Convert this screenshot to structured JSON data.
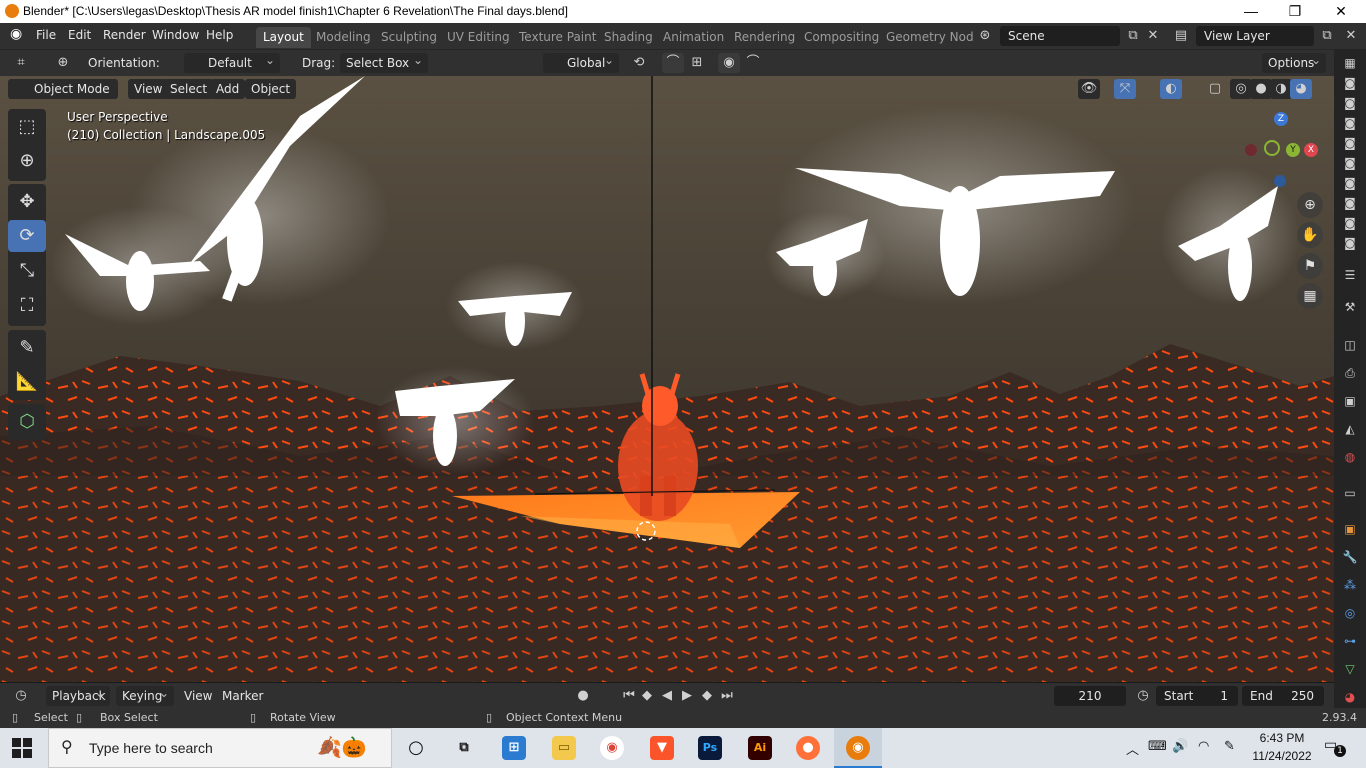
{
  "window": {
    "title": "Blender* [C:\\Users\\legas\\Desktop\\Thesis AR model finish1\\Chapter 6 Revelation\\The Final days.blend]",
    "minimize_icon": "minimize-icon",
    "maximize_icon": "maximize-icon",
    "close_icon": "close-icon"
  },
  "menubar": {
    "menus": [
      "File",
      "Edit",
      "Render",
      "Window",
      "Help"
    ],
    "workspaces": [
      "Layout",
      "Modeling",
      "Sculpting",
      "UV Editing",
      "Texture Paint",
      "Shading",
      "Animation",
      "Rendering",
      "Compositing",
      "Geometry Nod"
    ],
    "active_workspace": "Layout",
    "scene": "Scene",
    "view_layer": "View Layer"
  },
  "toolheader": {
    "orientation_label": "Orientation:",
    "orientation_value": "Default",
    "drag_label": "Drag:",
    "drag_value": "Select Box",
    "transform_orientation": "Global",
    "options_label": "Options"
  },
  "viewport_header": {
    "mode": "Object Mode",
    "menus": [
      "View",
      "Select",
      "Add",
      "Object"
    ]
  },
  "viewport": {
    "perspective": "User Perspective",
    "collection_info": "(210) Collection | Landscape.005",
    "gizmo": {
      "z": "Z",
      "y": "Y",
      "x": "X"
    }
  },
  "timeline": {
    "menus": [
      "Playback",
      "Keying",
      "View",
      "Marker"
    ],
    "current_frame": "210",
    "start_label": "Start",
    "start_value": "1",
    "end_label": "End",
    "end_value": "250"
  },
  "statusbar": {
    "select": "Select",
    "box_select": "Box Select",
    "rotate_view": "Rotate View",
    "context_menu": "Object Context Menu",
    "version": "2.93.4"
  },
  "taskbar": {
    "search_placeholder": "Type here to search",
    "time": "6:43 PM",
    "date": "11/24/2022",
    "notifications": "1",
    "apps": [
      "task-view",
      "store",
      "file-explorer",
      "chrome",
      "brave",
      "photoshop",
      "illustrator",
      "firefox",
      "blender"
    ]
  },
  "colors": {
    "accent": "#4772b3",
    "lava": "#ff5a14",
    "blender_orange": "#e87d0d"
  }
}
